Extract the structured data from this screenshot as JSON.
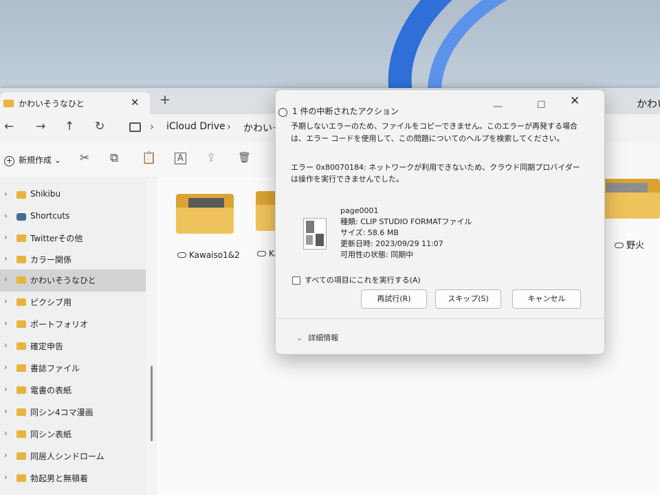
{
  "explorer": {
    "tab_title": "かわいそうなひと",
    "tab_close": "✕",
    "new_tab": "+",
    "window_title_right": "かわい",
    "nav": {
      "back": "←",
      "forward": "→",
      "up": "↑",
      "refresh": "↻"
    },
    "breadcrumb": {
      "sep": "›",
      "item1": "iCloud Drive",
      "item2": "かわいそ"
    },
    "toolbar": {
      "new_label": "新規作成",
      "new_caret": "⌄",
      "cut_icon": "✂",
      "copy_icon": "⧉",
      "paste_icon": "📋",
      "rename_icon": "A",
      "share_icon": "⇪",
      "delete_icon": "🗑"
    },
    "sidebar_chevron": "›",
    "sidebar": [
      {
        "label": "Shikibu"
      },
      {
        "label": "Shortcuts"
      },
      {
        "label": "Twitterその他"
      },
      {
        "label": "カラー関係"
      },
      {
        "label": "かわいそうなひと"
      },
      {
        "label": "ピクシブ用"
      },
      {
        "label": "ポートフォリオ"
      },
      {
        "label": "確定申告"
      },
      {
        "label": "書誌ファイル"
      },
      {
        "label": "電書の表紙"
      },
      {
        "label": "同シン4コマ漫画"
      },
      {
        "label": "同シン表紙"
      },
      {
        "label": "同居人シンドローム"
      },
      {
        "label": "勃起男と無頓着"
      }
    ],
    "folders": [
      {
        "label": "Kawaiso1&2"
      },
      {
        "label": "Ka"
      },
      {
        "label": "野火"
      }
    ]
  },
  "dialog": {
    "title": "1 件の中断されたアクション",
    "minimize": "—",
    "maximize": "☐",
    "close": "✕",
    "message": "予期しないエラーのため、ファイルをコピーできません。このエラーが再発する場合は、エラー コードを使用して、この問題についてのヘルプを検索してください。",
    "error": "エラー 0x80070184: ネットワークが利用できないため、クラウド同期プロバイダーは操作を実行できませんでした。",
    "file": {
      "name": "page0001",
      "type": "種類: CLIP STUDIO FORMATファイル",
      "size": "サイズ: 58.6 MB",
      "modified": "更新日時: 2023/09/29 11:07",
      "availability": "可用性の状態: 同期中"
    },
    "apply_all_label": "すべての項目にこれを実行する(A)",
    "buttons": {
      "retry": "再試行(R)",
      "skip": "スキップ(S)",
      "cancel": "キャンセル"
    },
    "details_chevron": "⌄",
    "details_label": "詳細情報"
  }
}
